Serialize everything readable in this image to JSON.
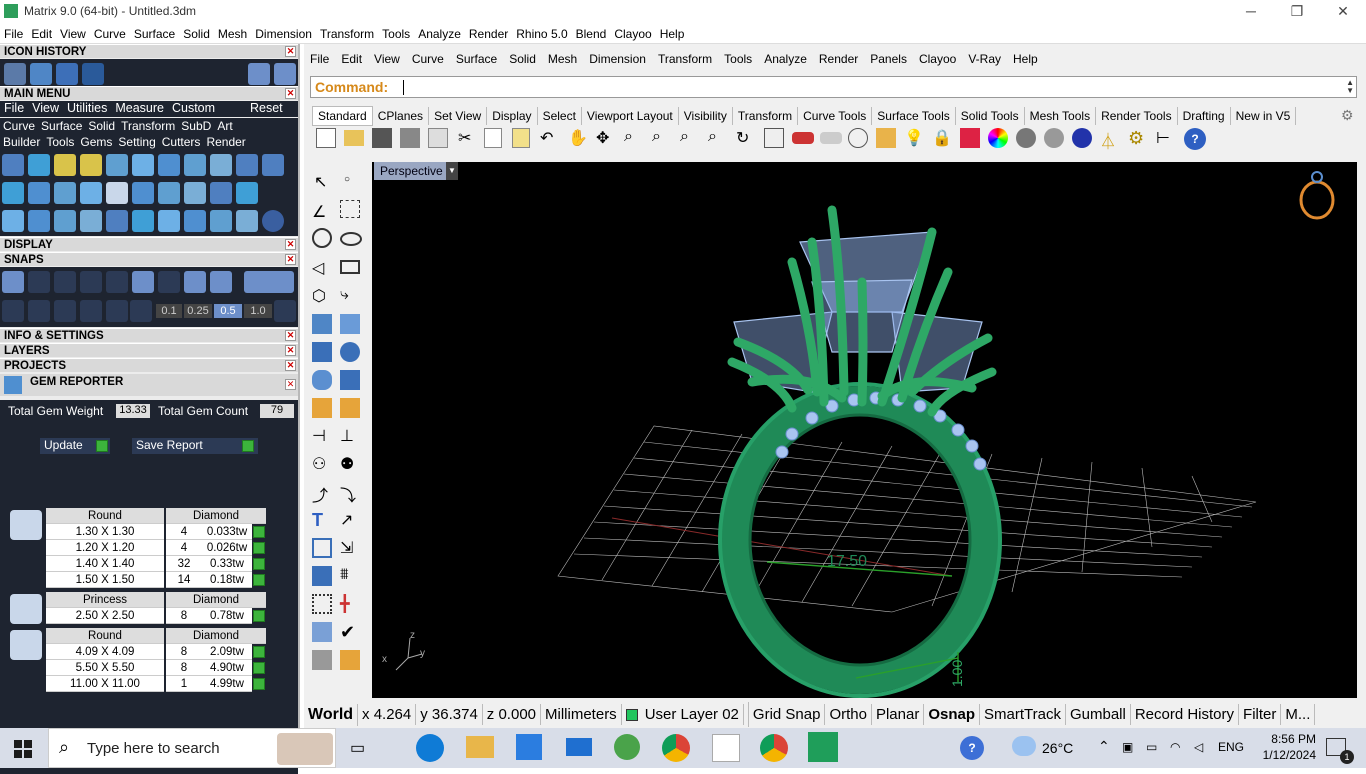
{
  "window": {
    "title": "Matrix 9.0 (64-bit) - Untitled.3dm"
  },
  "menubar": [
    "File",
    "Edit",
    "View",
    "Curve",
    "Surface",
    "Solid",
    "Mesh",
    "Dimension",
    "Transform",
    "Tools",
    "Analyze",
    "Render",
    "Rhino 5.0",
    "Blend",
    "Clayoo",
    "Help"
  ],
  "left": {
    "icon_history": "ICON HISTORY",
    "main_menu": "MAIN MENU",
    "main_menu_items": [
      "File",
      "View",
      "Utilities",
      "Measure",
      "Custom"
    ],
    "reset": "Reset",
    "cats1": [
      "Curve",
      "Surface",
      "Solid",
      "Transform",
      "SubD",
      "Art"
    ],
    "cats2": [
      "Builder",
      "Tools",
      "Gems",
      "Setting",
      "Cutters",
      "Render"
    ],
    "display": "DISPLAY",
    "snaps": "SNAPS",
    "snap_values": [
      "0.1",
      "0.25",
      "0.5",
      "1.0"
    ],
    "info": "INFO & SETTINGS",
    "layers": "LAYERS",
    "projects": "PROJECTS",
    "gem_reporter": "GEM REPORTER",
    "total_weight_label": "Total Gem Weight",
    "total_weight": "13.33",
    "total_count_label": "Total Gem Count",
    "total_count": "79",
    "update": "Update",
    "save_report": "Save Report",
    "groups": [
      {
        "shape": "Round",
        "material": "Diamond",
        "rows": [
          [
            "1.30 X 1.30",
            "4",
            "0.033tw"
          ],
          [
            "1.20 X 1.20",
            "4",
            "0.026tw"
          ],
          [
            "1.40 X 1.40",
            "32",
            "0.33tw"
          ],
          [
            "1.50 X 1.50",
            "14",
            "0.18tw"
          ]
        ]
      },
      {
        "shape": "Princess",
        "material": "Diamond",
        "rows": [
          [
            "2.50 X 2.50",
            "8",
            "0.78tw"
          ]
        ]
      },
      {
        "shape": "Round",
        "material": "Diamond",
        "rows": [
          [
            "4.09 X 4.09",
            "8",
            "2.09tw"
          ],
          [
            "5.50 X 5.50",
            "8",
            "4.90tw"
          ],
          [
            "11.00 X 11.00",
            "1",
            "4.99tw"
          ]
        ]
      }
    ]
  },
  "rhino_menu": [
    "File",
    "Edit",
    "View",
    "Curve",
    "Surface",
    "Solid",
    "Mesh",
    "Dimension",
    "Transform",
    "Tools",
    "Analyze",
    "Render",
    "Panels",
    "Clayoo",
    "V-Ray",
    "Help"
  ],
  "command_label": "Command:",
  "tabs": [
    "Standard",
    "CPlanes",
    "Set View",
    "Display",
    "Select",
    "Viewport Layout",
    "Visibility",
    "Transform",
    "Curve Tools",
    "Surface Tools",
    "Solid Tools",
    "Mesh Tools",
    "Render Tools",
    "Drafting",
    "New in V5"
  ],
  "viewport": {
    "name": "Perspective",
    "dim1": "17.50",
    "dim2": "1.00"
  },
  "status": [
    "World",
    "x 4.264",
    "y 36.374",
    "z 0.000",
    "Millimeters",
    "User Layer 02",
    "Grid Snap",
    "Ortho",
    "Planar",
    "Osnap",
    "SmartTrack",
    "Gumball",
    "Record History",
    "Filter",
    "M..."
  ],
  "taskbar": {
    "search_placeholder": "Type here to search",
    "temp": "26°C",
    "lang": "ENG",
    "time": "8:56 PM",
    "date": "1/12/2024",
    "notif": "1"
  },
  "colors": {
    "accent": "#2e7d4f",
    "gem": "#a9c4f0",
    "ring": "#1f8a57"
  }
}
